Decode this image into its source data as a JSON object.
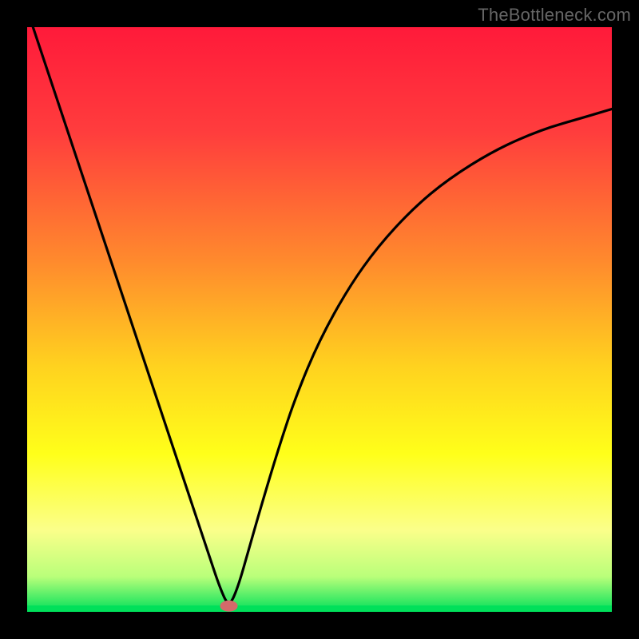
{
  "watermark": "TheBottleneck.com",
  "chart_data": {
    "type": "line",
    "title": "",
    "xlabel": "",
    "ylabel": "",
    "x_range": [
      0,
      100
    ],
    "y_range": [
      0,
      100
    ],
    "grid": false,
    "legend": false,
    "gradient_stops": [
      {
        "offset": 0.0,
        "color": "#ff1a3a"
      },
      {
        "offset": 0.18,
        "color": "#ff3d3d"
      },
      {
        "offset": 0.4,
        "color": "#ff8a2d"
      },
      {
        "offset": 0.58,
        "color": "#ffd21f"
      },
      {
        "offset": 0.73,
        "color": "#ffff1a"
      },
      {
        "offset": 0.86,
        "color": "#fbff8a"
      },
      {
        "offset": 0.94,
        "color": "#b9ff7a"
      },
      {
        "offset": 1.0,
        "color": "#00e05a"
      }
    ],
    "marker": {
      "x": 34.5,
      "y": 99,
      "color": "#d46a6a"
    },
    "series": [
      {
        "name": "curve",
        "data": [
          {
            "x": 0.0,
            "y": -3.0
          },
          {
            "x": 3.0,
            "y": 6.0
          },
          {
            "x": 6.0,
            "y": 15.0
          },
          {
            "x": 10.0,
            "y": 27.0
          },
          {
            "x": 14.0,
            "y": 39.0
          },
          {
            "x": 18.0,
            "y": 51.0
          },
          {
            "x": 22.0,
            "y": 63.0
          },
          {
            "x": 26.0,
            "y": 75.0
          },
          {
            "x": 29.0,
            "y": 84.0
          },
          {
            "x": 31.0,
            "y": 90.0
          },
          {
            "x": 33.0,
            "y": 96.0
          },
          {
            "x": 34.5,
            "y": 99.2
          },
          {
            "x": 36.0,
            "y": 96.0
          },
          {
            "x": 38.0,
            "y": 89.0
          },
          {
            "x": 40.0,
            "y": 82.0
          },
          {
            "x": 43.0,
            "y": 72.0
          },
          {
            "x": 46.0,
            "y": 63.0
          },
          {
            "x": 50.0,
            "y": 53.5
          },
          {
            "x": 55.0,
            "y": 44.5
          },
          {
            "x": 60.0,
            "y": 37.5
          },
          {
            "x": 66.0,
            "y": 31.0
          },
          {
            "x": 72.0,
            "y": 26.0
          },
          {
            "x": 80.0,
            "y": 21.0
          },
          {
            "x": 88.0,
            "y": 17.5
          },
          {
            "x": 95.0,
            "y": 15.5
          },
          {
            "x": 100.0,
            "y": 14.0
          }
        ]
      }
    ]
  }
}
